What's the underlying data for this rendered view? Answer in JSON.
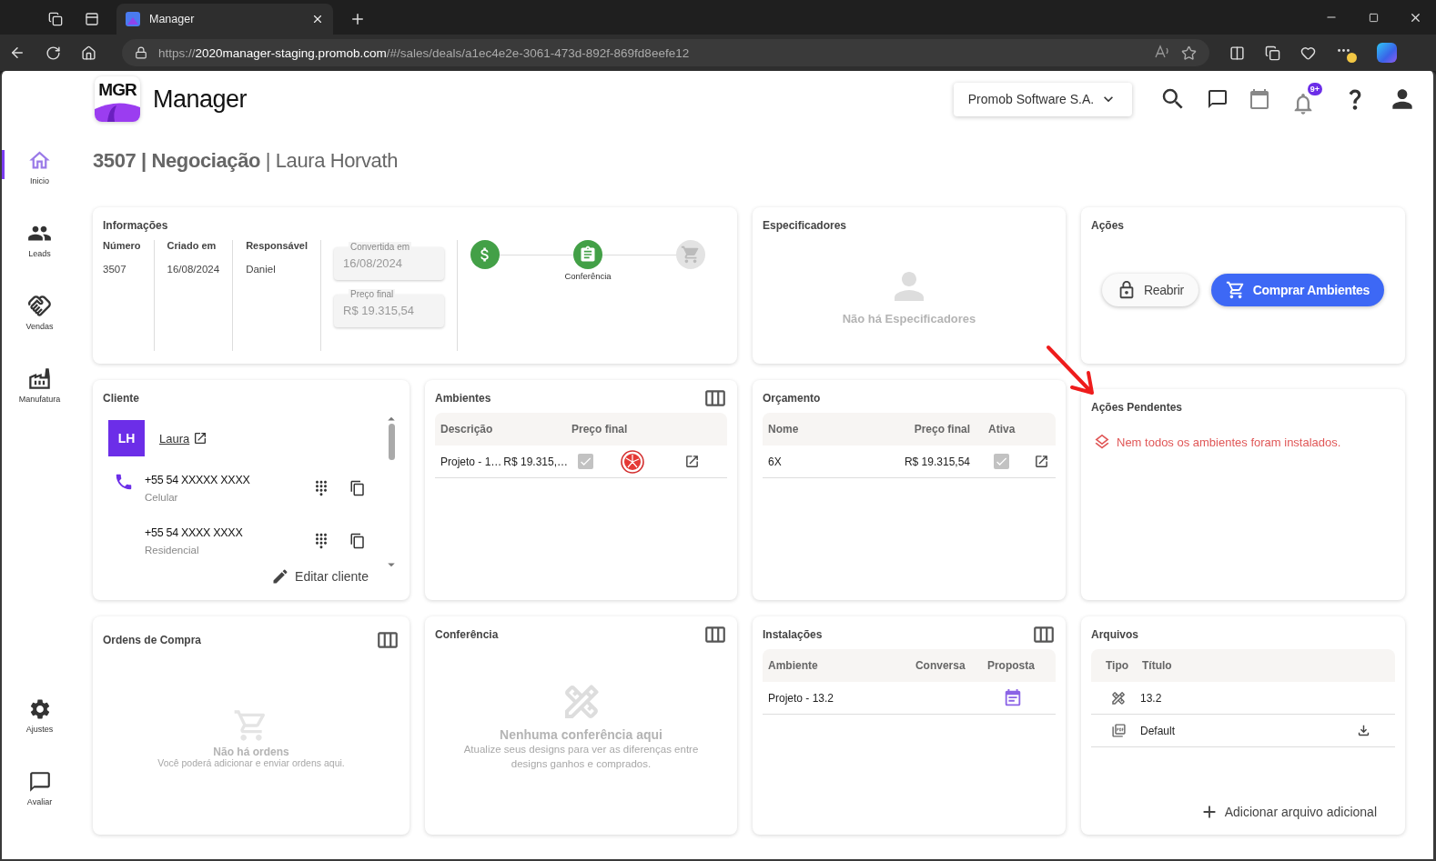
{
  "browser": {
    "tabs": [
      {
        "title": "Manager",
        "selected": true
      }
    ],
    "url": {
      "scheme": "https://",
      "host": "2020manager-staging.promob.com",
      "path": "/#/sales/deals/a1ec4e2e-3061-473d-892f-869fd8eefe12"
    }
  },
  "sidebar": {
    "items": [
      {
        "label": "Inicio",
        "selected": true
      },
      {
        "label": "Leads",
        "selected": false
      },
      {
        "label": "Vendas",
        "selected": false
      },
      {
        "label": "Manufatura",
        "selected": false
      }
    ],
    "bottom_items": [
      {
        "label": "Ajustes",
        "selected": false
      },
      {
        "label": "Avaliar",
        "selected": false
      }
    ]
  },
  "header": {
    "logo": "MGR",
    "app_name": "Manager",
    "company": "Promob Software S.A.",
    "notification_badge": "9+"
  },
  "title": "**3507 | Negociação** | Laura Horvath",
  "informacoes": {
    "title": "Informações",
    "fields": [
      {
        "label": "Número",
        "value": "3507"
      },
      {
        "label": "Criado em",
        "value": "16/08/2024"
      },
      {
        "label": "Responsável",
        "value": "Daniel"
      }
    ],
    "readonly_fields": [
      {
        "label": "Convertida em",
        "value": "16/08/2024"
      },
      {
        "label": "Preço final",
        "value": "R$ 19.315,54"
      }
    ],
    "steps": [
      {
        "completed": true
      },
      {
        "completed": true,
        "label": "Conferência"
      },
      {
        "completed": false
      }
    ]
  },
  "especificadores": {
    "title": "Especificadores",
    "empty": "Não há Especificadores"
  },
  "acoes": {
    "title": "Ações",
    "buttons": [
      {
        "label": "Reabrir",
        "kind": "secondary"
      },
      {
        "label": "Comprar Ambientes",
        "kind": "primary"
      }
    ]
  },
  "cliente": {
    "title": "Cliente",
    "initials": "LH",
    "name": "Laura",
    "phones": [
      {
        "number": "+55 54 XXXXX XXXX",
        "type": "Celular"
      },
      {
        "number": "+55 54 XXXX XXXX",
        "type": "Residencial"
      }
    ],
    "edit": "Editar cliente"
  },
  "ambientes": {
    "title": "Ambientes",
    "columns": [
      "Descrição",
      "Preço final"
    ],
    "rows": [
      {
        "descricao": "Projeto - 1…",
        "preco": "R$ 19.315,…",
        "checked": true
      }
    ]
  },
  "orcamento": {
    "title": "Orçamento",
    "columns": [
      "Nome",
      "Preço final",
      "Ativa"
    ],
    "rows": [
      {
        "nome": "6X",
        "preco": "R$ 19.315,54",
        "ativa": true
      }
    ]
  },
  "acoes_pendentes": {
    "title": "Ações Pendentes",
    "items": [
      "Nem todos os ambientes foram instalados."
    ]
  },
  "ordens": {
    "title": "Ordens de Compra",
    "empty_title": "Não há ordens",
    "empty_text": "Você poderá adicionar e enviar ordens aqui."
  },
  "conferencia": {
    "title": "Conferência",
    "empty_title": "Nenhuma conferência aqui",
    "empty_text": "Atualize seus designs para ver as diferenças entre designs ganhos e comprados."
  },
  "instalacoes": {
    "title": "Instalações",
    "columns": [
      "Ambiente",
      "Conversa",
      "Proposta"
    ],
    "rows": [
      {
        "ambiente": "Projeto - 13.2"
      }
    ]
  },
  "arquivos": {
    "title": "Arquivos",
    "columns": [
      "Tipo",
      "Título"
    ],
    "rows": [
      {
        "kind": "design",
        "title": "13.2",
        "downloadable": false
      },
      {
        "kind": "pdf",
        "title": "Default",
        "downloadable": true
      }
    ],
    "add": "Adicionar arquivo adicional"
  }
}
